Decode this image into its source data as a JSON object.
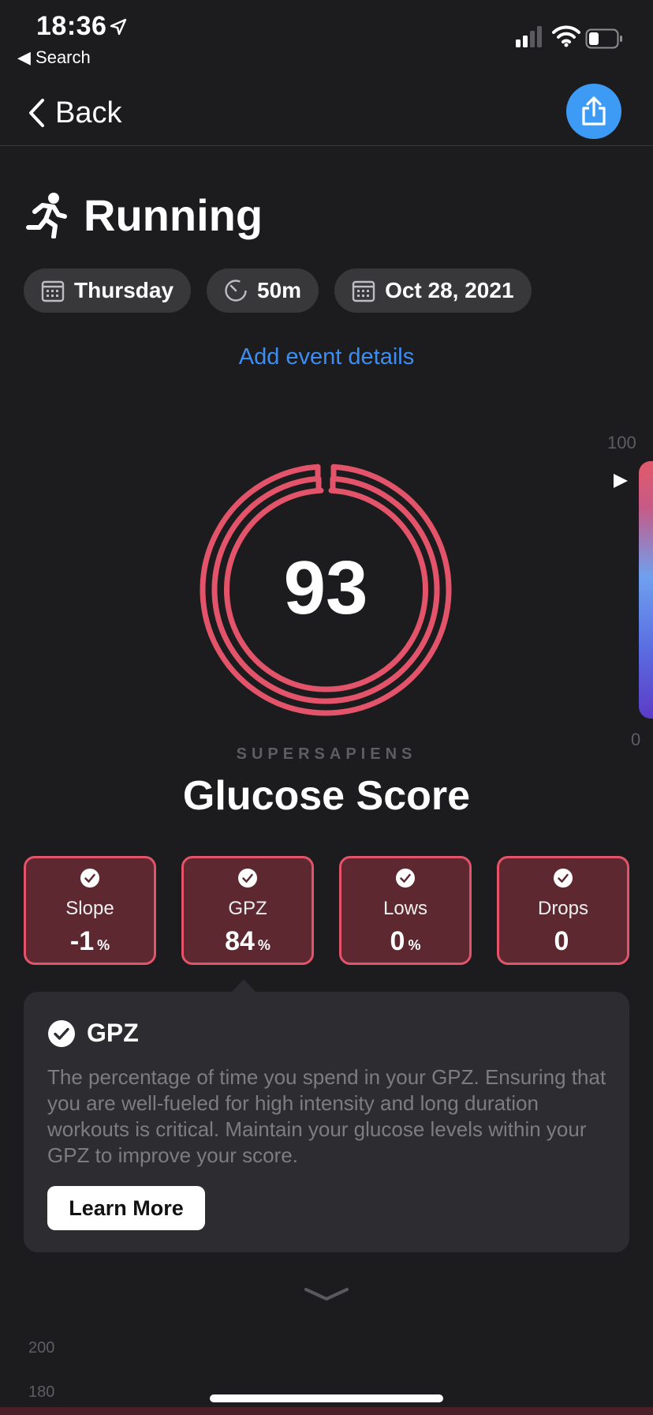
{
  "status_bar": {
    "time": "18:36",
    "back_app": "◀ Search"
  },
  "nav": {
    "back_label": "Back"
  },
  "activity": {
    "title": "Running",
    "chips": [
      {
        "label": "Thursday",
        "icon": "calendar-icon"
      },
      {
        "label": "50m",
        "icon": "timer-icon"
      },
      {
        "label": "Oct 28, 2021",
        "icon": "calendar-icon"
      }
    ],
    "add_event_link": "Add event details"
  },
  "score": {
    "value": "93",
    "scale_max": "100",
    "scale_min": "0",
    "brand": "SUPERSAPIENS",
    "label": "Glucose Score",
    "ring_color": "#e3546a"
  },
  "metrics": [
    {
      "label": "Slope",
      "value": "-1",
      "unit": "%"
    },
    {
      "label": "GPZ",
      "value": "84",
      "unit": "%"
    },
    {
      "label": "Lows",
      "value": "0",
      "unit": "%"
    },
    {
      "label": "Drops",
      "value": "0",
      "unit": ""
    }
  ],
  "info": {
    "title": "GPZ",
    "description": "The percentage of time you spend in your GPZ. Ensuring that you are well-fueled for high intensity and long duration workouts is critical. Maintain your glucose levels within your GPZ to improve your score.",
    "button": "Learn More"
  },
  "chart_axis": {
    "tick_200": "200",
    "tick_180": "180"
  },
  "colors": {
    "accent_blue": "#3d9bf6",
    "accent_red": "#e3546a",
    "background": "#1c1c1e"
  }
}
